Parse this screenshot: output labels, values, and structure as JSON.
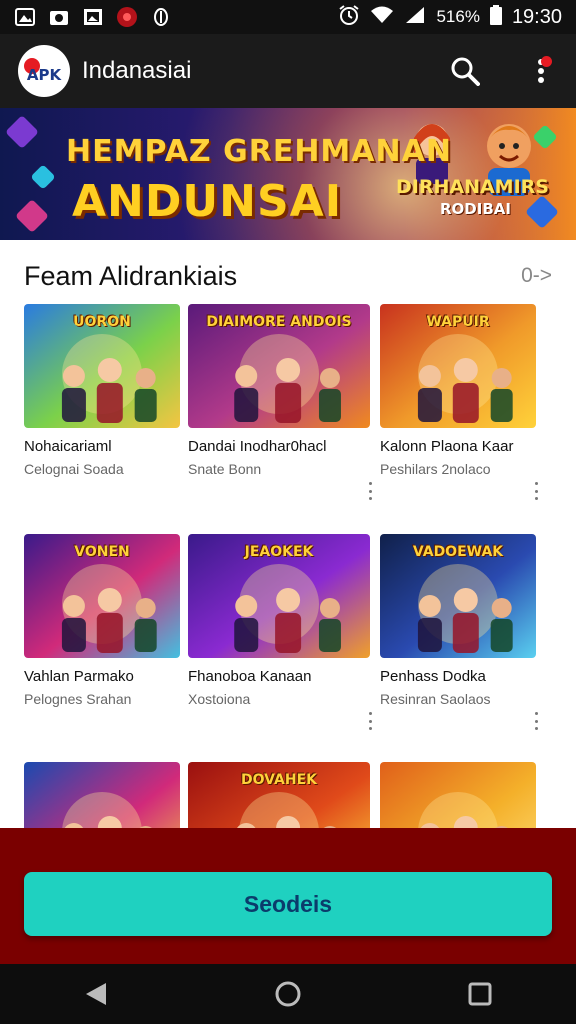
{
  "status_bar": {
    "time": "19:30",
    "battery_text": "516%",
    "icons": [
      "photo-icon",
      "camera-icon",
      "gallery-icon",
      "red-app-icon",
      "shield-icon",
      "alarm-icon",
      "wifi-icon",
      "signal-icon",
      "battery-icon"
    ]
  },
  "app_bar": {
    "logo_text": "APK",
    "title": "Indanasiai",
    "actions": [
      "search-icon",
      "more-vertical-icon"
    ],
    "notification_color": "#e51b23"
  },
  "banner": {
    "line1": "HEMPAZ GREHMANAN",
    "line2": "ANDUNSAI",
    "side_title": "DIRHANAMIRS",
    "side_sub": "RODIBAI"
  },
  "section": {
    "title": "Feam Alidrankiais",
    "more": "0->"
  },
  "games": [
    {
      "name": "Nohaicariaml",
      "sub": "Celognai Soada",
      "thumb_text": "UORON",
      "menu": false,
      "colors": [
        "#2a7be0",
        "#7bd14a",
        "#f4c542"
      ]
    },
    {
      "name": "Dandai Inodhar0hacl",
      "sub": "Snate Bonn",
      "thumb_text": "DIAIMORE ANDOIS",
      "menu": true,
      "colors": [
        "#5a1a7a",
        "#b23a8a",
        "#f08a1f"
      ]
    },
    {
      "name": "Kalonn Plaona Kaar",
      "sub": "Peshilars 2nolaco",
      "thumb_text": "WAPUIR",
      "menu": true,
      "colors": [
        "#c8321e",
        "#f09a2a",
        "#ffd23a"
      ]
    },
    {
      "name": "Vahlan Parmako",
      "sub": "Pelognes Srahan",
      "thumb_text": "VONEN",
      "menu": false,
      "colors": [
        "#3a1a8a",
        "#d12a7a",
        "#43c0e0"
      ]
    },
    {
      "name": "Fhanoboa Kanaan",
      "sub": "Xostoiona",
      "thumb_text": "JEAOKEK",
      "menu": true,
      "colors": [
        "#3a1a8a",
        "#8a2ad1",
        "#f0a02a"
      ]
    },
    {
      "name": "Penhass Dodka",
      "sub": "Resinran Saolaos",
      "thumb_text": "VADOEWAK",
      "menu": true,
      "colors": [
        "#10204a",
        "#2a4ab0",
        "#5ad0f0"
      ]
    },
    {
      "name": "",
      "sub": "",
      "thumb_text": "",
      "menu": false,
      "colors": [
        "#1a4ab0",
        "#d12a7a",
        "#f4c542"
      ]
    },
    {
      "name": "",
      "sub": "",
      "thumb_text": "DOVAHEK",
      "menu": false,
      "colors": [
        "#9a1010",
        "#e04a1a",
        "#ffd23a"
      ]
    },
    {
      "name": "",
      "sub": "",
      "thumb_text": "",
      "menu": false,
      "colors": [
        "#e0601a",
        "#f4b02a",
        "#ffe07a"
      ]
    }
  ],
  "cta": {
    "label": "Seodeis",
    "bg_color": "#1fd1c0",
    "panel_color": "#7a0000"
  },
  "nav": [
    "back-icon",
    "home-icon",
    "recents-icon"
  ]
}
